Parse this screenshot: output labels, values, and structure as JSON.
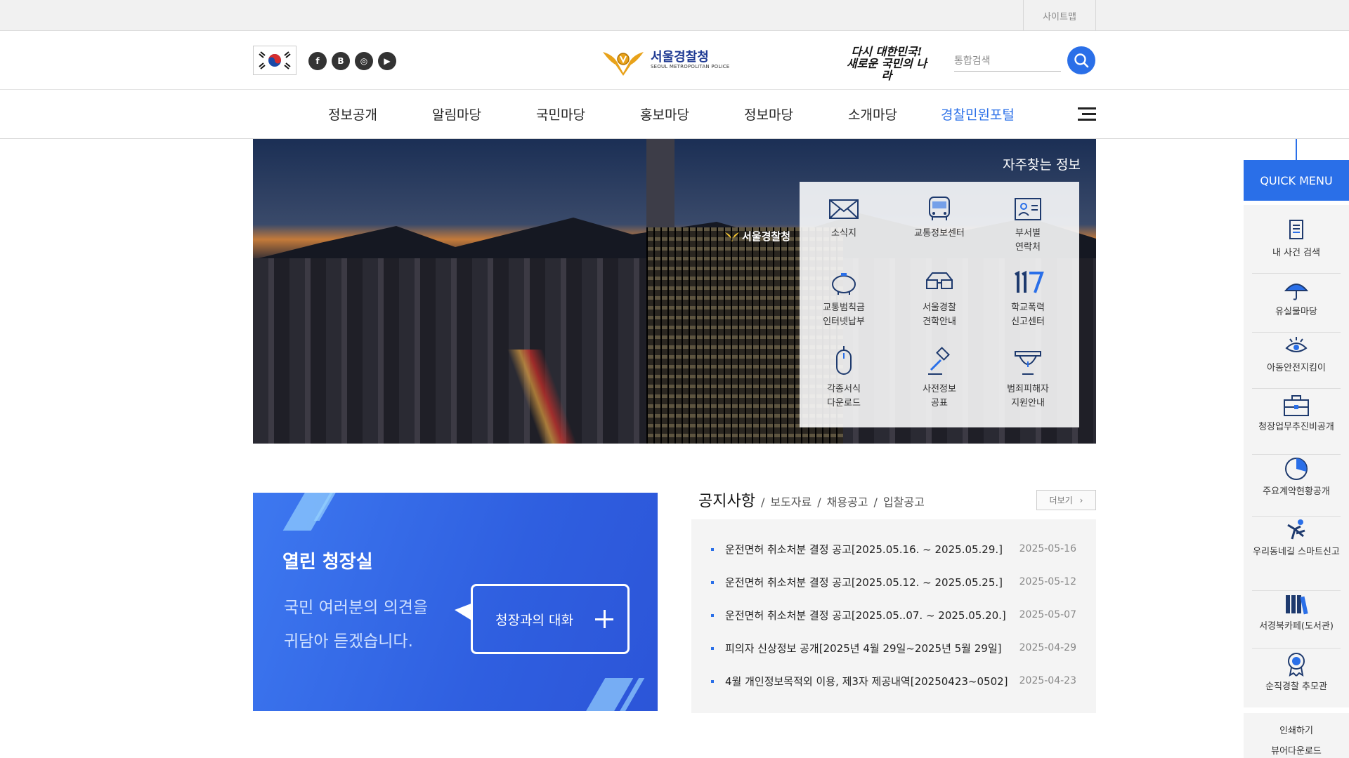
{
  "topbar": {
    "sitemap": "사이트맵"
  },
  "header": {
    "sns": [
      {
        "name": "facebook-icon",
        "glyph": "f"
      },
      {
        "name": "blog-icon",
        "glyph": "B"
      },
      {
        "name": "instagram-icon",
        "glyph": "◎"
      },
      {
        "name": "youtube-icon",
        "glyph": "▶"
      }
    ],
    "logo_ko": "서울경찰청",
    "logo_en": "SEOUL METROPOLITAN POLICE",
    "slogan_line1": "다시 대한민국!",
    "slogan_line2": "새로운 국민의 나라",
    "search_placeholder": "통합검색"
  },
  "gnb": [
    "정보공개",
    "알림마당",
    "국민마당",
    "홍보마당",
    "정보마당",
    "소개마당",
    "경찰민원포털"
  ],
  "hero": {
    "building_sign": "서울경찰청",
    "title": "자주찾는 정보",
    "items": [
      {
        "label": "소식지",
        "icon": "envelope-icon"
      },
      {
        "label": "교통정보센터",
        "icon": "bus-icon"
      },
      {
        "label": "부서별\n연락처",
        "icon": "contact-card-icon"
      },
      {
        "label": "교통범칙금\n인터넷납부",
        "icon": "piggy-bank-icon"
      },
      {
        "label": "서울경찰\n견학안내",
        "icon": "3d-glasses-icon"
      },
      {
        "label": "학교폭력\n신고센터",
        "icon": "117-icon"
      },
      {
        "label": "각종서식\n다운로드",
        "icon": "mouse-icon"
      },
      {
        "label": "사전정보\n공표",
        "icon": "gavel-icon"
      },
      {
        "label": "범죄피해자\n지원안내",
        "icon": "siren-icon"
      }
    ]
  },
  "chief": {
    "title": "열린 청장실",
    "text_line1": "국민 여러분의 의견을",
    "text_line2": "귀담아 듣겠습니다.",
    "button": "청장과의 대화"
  },
  "notice": {
    "tabs": [
      "공지사항",
      "보도자료",
      "채용공고",
      "입찰공고"
    ],
    "more": "더보기",
    "items": [
      {
        "title": "운전면허 취소처분 결정 공고[2025.05.16. ~ 2025.05.29.]",
        "date": "2025-05-16"
      },
      {
        "title": "운전면허 취소처분 결정 공고[2025.05.12. ~ 2025.05.25.]",
        "date": "2025-05-12"
      },
      {
        "title": "운전면허 취소처분 결정 공고[2025.05..07. ~ 2025.05.20.]",
        "date": "2025-05-07"
      },
      {
        "title": "피의자 신상정보 공개[2025년 4월 29일~2025년 5월 29일]",
        "date": "2025-04-29"
      },
      {
        "title": "4월 개인정보목적외 이용, 제3자 제공내역[20250423~0502]",
        "date": "2025-04-23"
      }
    ]
  },
  "quick_menu": {
    "title": "QUICK MENU",
    "items": [
      {
        "label": "내 사건 검색",
        "icon": "document-search-icon"
      },
      {
        "label": "유실물마당",
        "icon": "umbrella-icon"
      },
      {
        "label": "아동안전지킴이",
        "icon": "eye-icon"
      },
      {
        "label": "청장업무추진비공개",
        "icon": "briefcase-icon"
      },
      {
        "label": "주요계약현황공개",
        "icon": "pie-chart-icon"
      },
      {
        "label": "우리동네길 스마트신고",
        "icon": "running-person-icon"
      },
      {
        "label": "서경북카페(도서관)",
        "icon": "books-icon"
      },
      {
        "label": "순직경찰 추모관",
        "icon": "medal-icon"
      }
    ],
    "print": "인쇄하기",
    "viewer": "뷰어다운로드"
  },
  "colors": {
    "accent": "#2a6fe8",
    "chief_bg": "#2f5fe0"
  }
}
